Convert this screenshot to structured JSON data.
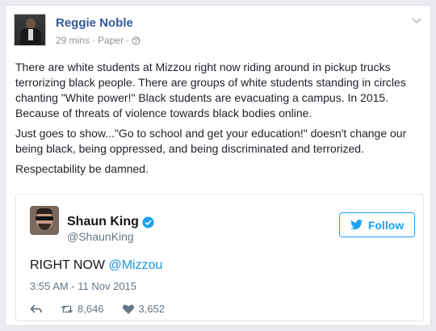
{
  "post": {
    "author": "Reggie Noble",
    "time": "29 mins",
    "source": "Paper",
    "separator": "·",
    "paragraphs": [
      "There are white students at Mizzou right now riding around in pickup trucks terrorizing black people. There are groups of white students standing in circles chanting \"White power!\" Black students are evacuating a campus. In 2015. Because of threats of violence towards black bodies online.",
      "Just goes to show...\"Go to school and get your education!\" doesn't change our being black, being oppressed, and being discriminated and terrorized.",
      "Respectability be damned."
    ]
  },
  "tweet": {
    "name": "Shaun King",
    "handle": "@ShaunKing",
    "follow_label": "Follow",
    "text_prefix": "RIGHT NOW ",
    "mention": "@Mizzou",
    "timestamp": "3:55 AM - 11 Nov 2015",
    "retweets": "8,646",
    "likes": "3,652"
  },
  "colors": {
    "fb_link": "#365899",
    "twitter_blue": "#1da1f2",
    "muted": "#657786"
  }
}
